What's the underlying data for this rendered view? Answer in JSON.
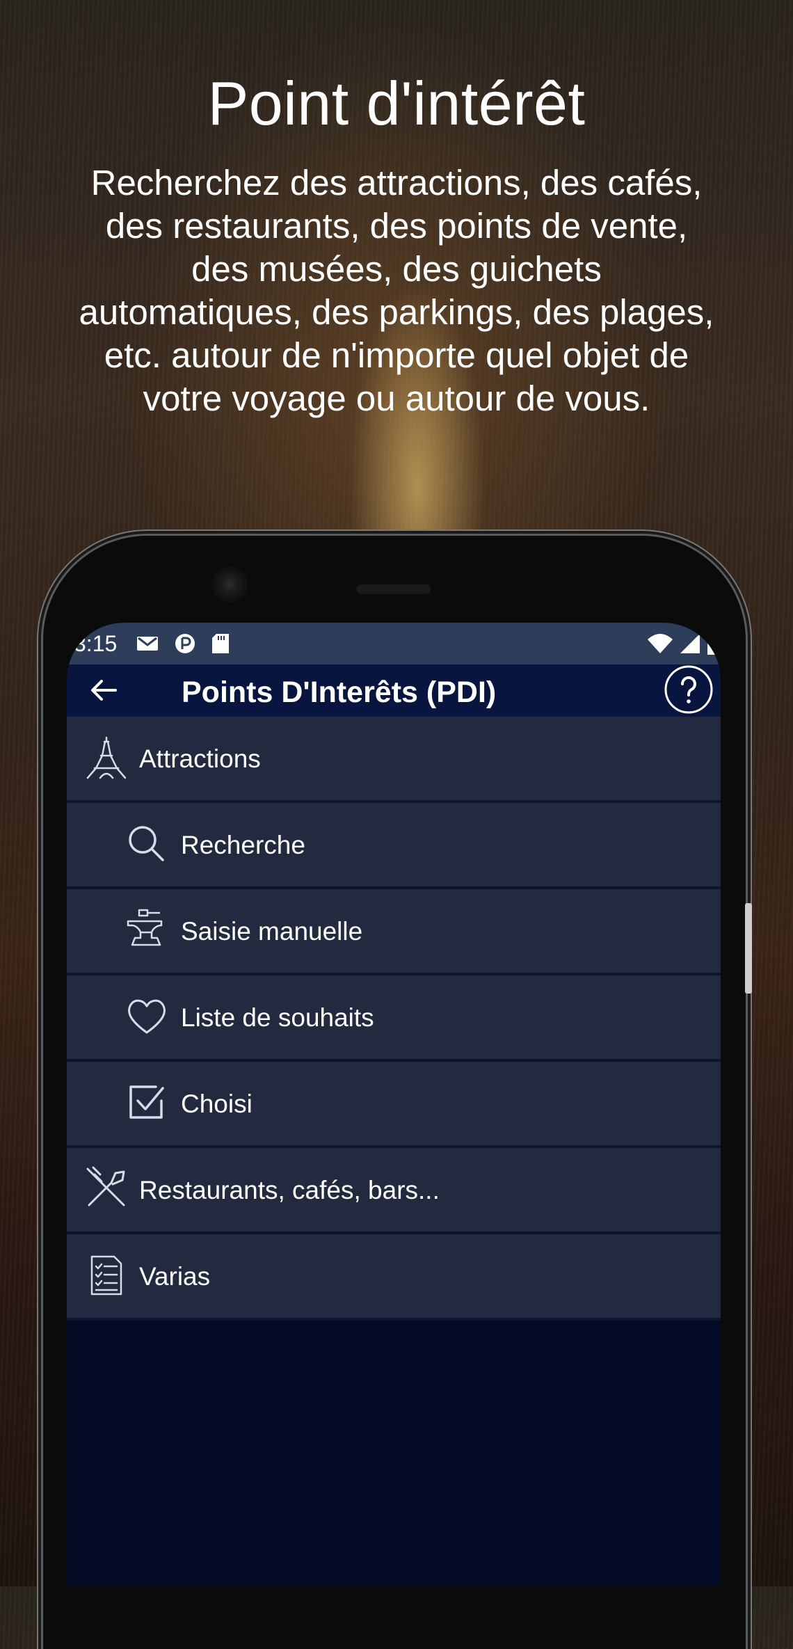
{
  "promo": {
    "title": "Point d'intérêt",
    "description": "Recherchez des attractions, des cafés, des restaurants, des points de vente, des musées, des guichets automatiques, des parkings, des plages, etc. autour de n'importe quel objet de votre voyage ou autour de vous."
  },
  "statusbar": {
    "time": "3:15",
    "icons": [
      "gmail-icon",
      "vpn-icon",
      "sd-card-icon",
      "wifi-icon",
      "signal-icon",
      "battery-icon"
    ]
  },
  "appbar": {
    "title": "Points D'Interêts (PDI)",
    "back_icon": "arrow-left-icon",
    "help_icon": "help-circle-icon"
  },
  "menu": {
    "items": [
      {
        "label": "Attractions",
        "icon": "eiffel-tower-icon",
        "level": 0
      },
      {
        "label": "Recherche",
        "icon": "search-icon",
        "level": 1
      },
      {
        "label": "Saisie manuelle",
        "icon": "anvil-icon",
        "level": 1
      },
      {
        "label": "Liste de souhaits",
        "icon": "heart-icon",
        "level": 1
      },
      {
        "label": "Choisi",
        "icon": "checkbox-icon",
        "level": 1
      },
      {
        "label": "Restaurants, cafés, bars...",
        "icon": "fork-knife-icon",
        "level": 0
      },
      {
        "label": "Varias",
        "icon": "checklist-icon",
        "level": 0
      }
    ]
  },
  "colors": {
    "statusbar": "#2d3d5a",
    "appbar": "#08163f",
    "row": "#232a40",
    "screen": "#020a24"
  }
}
